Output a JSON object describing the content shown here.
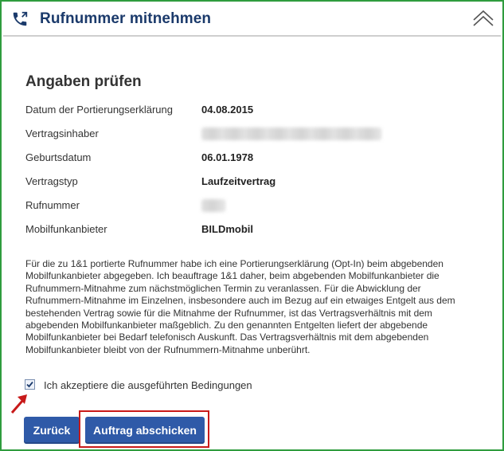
{
  "header": {
    "title": "Rufnummer mitnehmen",
    "icon": "phone-forward-icon",
    "collapse_icon": "chevron-up-icon"
  },
  "section": {
    "title": "Angaben prüfen"
  },
  "details": [
    {
      "label": "Datum der Portierungserklärung",
      "value": "04.08.2015"
    },
    {
      "label": "Vertragsinhaber",
      "value": null
    },
    {
      "label": "Geburtsdatum",
      "value": "06.01.1978"
    },
    {
      "label": "Vertragstyp",
      "value": "Laufzeitvertrag"
    },
    {
      "label": "Rufnummer",
      "value": null
    },
    {
      "label": "Mobilfunkanbieter",
      "value": "BILDmobil"
    }
  ],
  "terms": {
    "lines": [
      "Für die zu 1&1 portierte Rufnummer habe ich eine Portierungserklärung (Opt-In) beim abgebenden",
      "Mobilfunkanbieter abgegeben. Ich beauftrage 1&1 daher, beim abgebenden Mobilfunkanbieter die",
      "Rufnummern-Mitnahme zum nächstmöglichen Termin zu veranlassen. Für die Abwicklung der",
      "Rufnummern-Mitnahme im Einzelnen, insbesondere auch im Bezug auf ein etwaiges Entgelt aus dem",
      "bestehenden Vertrag sowie für die Mitnahme der Rufnummer, ist das Vertragsverhältnis mit dem",
      "abgebenden Mobilfunkanbieter maßgeblich. Zu den genannten Entgelten liefert der abgebende",
      "Mobilfunkanbieter bei Bedarf telefonisch Auskunft. Das Vertragsverhältnis mit dem abgebenden",
      "Mobilfunkanbieter bleibt von der Rufnummern-Mitnahme unberührt."
    ]
  },
  "accept": {
    "label": "Ich akzeptiere die ausgeführten Bedingungen",
    "checked": true
  },
  "buttons": {
    "back": "Zurück",
    "submit": "Auftrag abschicken"
  },
  "colors": {
    "frame_border": "#2f9c3e",
    "title_color": "#1b3a6b",
    "button_bg": "#2f5aa8",
    "annotation_red": "#c81a1a"
  }
}
